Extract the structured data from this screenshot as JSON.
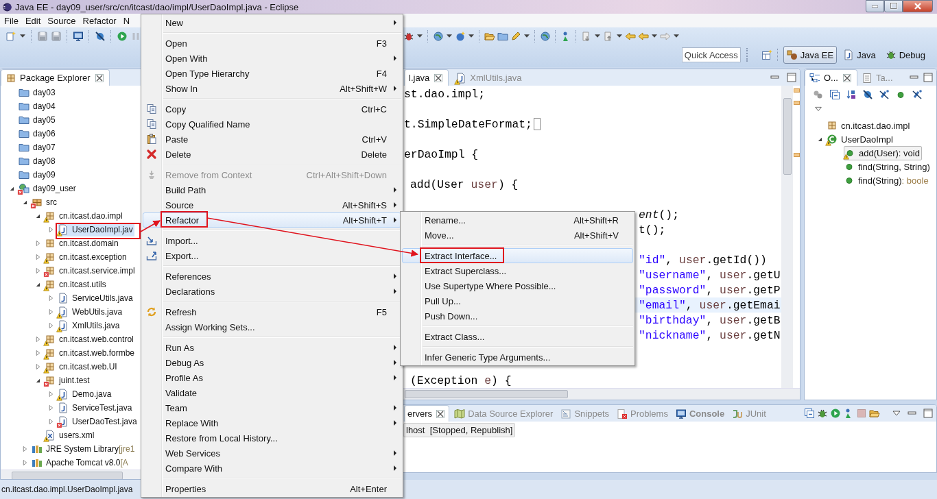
{
  "window": {
    "title": "Java EE - day09_user/src/cn/itcast/dao/impl/UserDaoImpl.java - Eclipse"
  },
  "menubar": [
    "File",
    "Edit",
    "Source",
    "Refactor",
    "N"
  ],
  "quick_access": {
    "placeholder": "Quick Access"
  },
  "perspectives": [
    {
      "label": "Java EE",
      "kind": "javaee",
      "selected": true
    },
    {
      "label": "Java",
      "kind": "java",
      "selected": false
    },
    {
      "label": "Debug",
      "kind": "debug",
      "selected": false
    }
  ],
  "package_explorer": {
    "title": "Package Explorer",
    "tree": [
      {
        "label": "day03",
        "kind": "folder",
        "warning": false,
        "error": false,
        "selected": false
      },
      {
        "label": "day04",
        "kind": "folder",
        "warning": false,
        "error": false,
        "selected": false
      },
      {
        "label": "day05",
        "kind": "folder",
        "warning": false,
        "error": false,
        "selected": false
      },
      {
        "label": "day06",
        "kind": "folder",
        "warning": false,
        "error": false,
        "selected": false
      },
      {
        "label": "day07",
        "kind": "folder",
        "warning": false,
        "error": false,
        "selected": false
      },
      {
        "label": "day08",
        "kind": "folder",
        "warning": false,
        "error": false,
        "selected": false
      },
      {
        "label": "day09",
        "kind": "folder",
        "warning": false,
        "error": false,
        "selected": false
      },
      {
        "label": "day09_user",
        "kind": "project",
        "warning": false,
        "error": true,
        "expanded": true,
        "selected": false,
        "children": [
          {
            "label": "src",
            "kind": "srcfolder",
            "warning": false,
            "error": true,
            "expanded": true,
            "selected": false,
            "children": [
              {
                "label": "cn.itcast.dao.impl",
                "kind": "package",
                "warning": true,
                "error": false,
                "expanded": true,
                "selected": false,
                "children": [
                  {
                    "label": "UserDaoImpl.jav",
                    "kind": "java",
                    "warning": true,
                    "error": false,
                    "expanded": false,
                    "selected": true
                  }
                ]
              },
              {
                "label": "cn.itcast.domain",
                "kind": "package",
                "warning": false,
                "error": false,
                "expanded": false,
                "selected": false
              },
              {
                "label": "cn.itcast.exception",
                "kind": "package",
                "warning": true,
                "error": false,
                "expanded": false,
                "selected": false
              },
              {
                "label": "cn.itcast.service.impl",
                "kind": "package",
                "warning": false,
                "error": true,
                "expanded": false,
                "selected": false
              },
              {
                "label": "cn.itcast.utils",
                "kind": "package",
                "warning": true,
                "error": false,
                "expanded": true,
                "selected": false,
                "children": [
                  {
                    "label": "ServiceUtils.java",
                    "kind": "java",
                    "warning": false,
                    "error": false,
                    "expanded": false,
                    "selected": false
                  },
                  {
                    "label": "WebUtils.java",
                    "kind": "java",
                    "warning": true,
                    "error": false,
                    "expanded": false,
                    "selected": false
                  },
                  {
                    "label": "XmlUtils.java",
                    "kind": "java",
                    "warning": true,
                    "error": false,
                    "expanded": false,
                    "selected": false
                  }
                ]
              },
              {
                "label": "cn.itcast.web.control",
                "kind": "package",
                "warning": true,
                "error": false,
                "expanded": false,
                "selected": false
              },
              {
                "label": "cn.itcast.web.formbe",
                "kind": "package",
                "warning": true,
                "error": false,
                "expanded": false,
                "selected": false
              },
              {
                "label": "cn.itcast.web.UI",
                "kind": "package",
                "warning": true,
                "error": false,
                "expanded": false,
                "selected": false
              },
              {
                "label": "juint.test",
                "kind": "package",
                "warning": false,
                "error": true,
                "expanded": true,
                "selected": false,
                "children": [
                  {
                    "label": "Demo.java",
                    "kind": "java",
                    "warning": true,
                    "error": false,
                    "expanded": false,
                    "selected": false
                  },
                  {
                    "label": "ServiceTest.java",
                    "kind": "java",
                    "warning": false,
                    "error": false,
                    "expanded": false,
                    "selected": false
                  },
                  {
                    "label": "UserDaoTest.java",
                    "kind": "java",
                    "warning": false,
                    "error": true,
                    "expanded": false,
                    "selected": false
                  }
                ]
              },
              {
                "label": "users.xml",
                "kind": "xml",
                "warning": true,
                "error": false,
                "selected": false
              }
            ]
          },
          {
            "label": "JRE System Library",
            "detail": "[jre1",
            "kind": "library",
            "warning": false,
            "error": false,
            "expanded": false,
            "selected": false
          },
          {
            "label": "Apache Tomcat v8.0",
            "detail": "[A",
            "kind": "library",
            "warning": false,
            "error": false,
            "expanded": false,
            "selected": false
          }
        ]
      }
    ]
  },
  "editor": {
    "tabs": [
      {
        "label": "l.java",
        "selected": true
      },
      {
        "label": "XmlUtils.java",
        "warning": true,
        "selected": false
      }
    ],
    "lines": [
      {
        "parts": [
          {
            "kind": "plain",
            "text": "st.dao.impl;"
          }
        ],
        "current": false,
        "folded": false
      },
      {
        "parts": [
          {
            "kind": "plain",
            "text": "t.SimpleDateFormat;"
          }
        ],
        "current": false,
        "folded": true
      },
      {
        "parts": [
          {
            "kind": "plain",
            "text": "erDaoImpl {"
          }
        ],
        "current": false,
        "folded": false
      },
      {
        "parts": [
          {
            "kind": "plain",
            "text": "add(User "
          },
          {
            "kind": "variable",
            "text": "user"
          },
          {
            "kind": "plain",
            "text": ") {"
          }
        ],
        "current": false,
        "folded": false
      },
      {
        "parts": [
          {
            "kind": "italic",
            "text": "ent"
          },
          {
            "kind": "plain",
            "text": "();"
          }
        ],
        "current": false,
        "folded": false
      },
      {
        "parts": [
          {
            "kind": "plain",
            "text": "t();"
          }
        ],
        "current": false,
        "folded": false
      },
      {
        "parts": [
          {
            "kind": "string",
            "text": "\"id\""
          },
          {
            "kind": "plain",
            "text": ", "
          },
          {
            "kind": "variable",
            "text": "user"
          },
          {
            "kind": "plain",
            "text": ".getId())"
          }
        ],
        "current": false,
        "folded": false
      },
      {
        "parts": [
          {
            "kind": "string",
            "text": "\"username\""
          },
          {
            "kind": "plain",
            "text": ", "
          },
          {
            "kind": "variable",
            "text": "user"
          },
          {
            "kind": "plain",
            "text": ".getU"
          }
        ],
        "current": false,
        "folded": false
      },
      {
        "parts": [
          {
            "kind": "string",
            "text": "\"password\""
          },
          {
            "kind": "plain",
            "text": ", "
          },
          {
            "kind": "variable",
            "text": "user"
          },
          {
            "kind": "plain",
            "text": ".getP"
          }
        ],
        "current": false,
        "folded": false
      },
      {
        "parts": [
          {
            "kind": "string",
            "text": "\"email\""
          },
          {
            "kind": "plain",
            "text": ", "
          },
          {
            "kind": "variable",
            "text": "user"
          },
          {
            "kind": "plain",
            "text": ".getEmai"
          }
        ],
        "current": true,
        "folded": false
      },
      {
        "parts": [
          {
            "kind": "string",
            "text": "\"birthday\""
          },
          {
            "kind": "plain",
            "text": ", "
          },
          {
            "kind": "variable",
            "text": "user"
          },
          {
            "kind": "plain",
            "text": ".getB"
          }
        ],
        "current": false,
        "folded": false
      },
      {
        "parts": [
          {
            "kind": "string",
            "text": "\"nickname\""
          },
          {
            "kind": "plain",
            "text": ", "
          },
          {
            "kind": "variable",
            "text": "user"
          },
          {
            "kind": "plain",
            "text": ".getN"
          }
        ],
        "current": false,
        "folded": false
      },
      {
        "parts": [
          {
            "kind": "plain",
            "text": "(Exception "
          },
          {
            "kind": "variable",
            "text": "e"
          },
          {
            "kind": "plain",
            "text": ") {"
          }
        ],
        "current": false,
        "folded": false
      }
    ]
  },
  "outline": {
    "tabs": [
      {
        "label": "O...",
        "kind": "outline",
        "selected": true
      },
      {
        "label": "Ta...",
        "kind": "tasks",
        "selected": false
      }
    ],
    "tree": [
      {
        "label": "cn.itcast.dao.impl",
        "kind": "package",
        "warning": false,
        "error": false,
        "selected": false
      },
      {
        "label": "UserDaoImpl",
        "kind": "class",
        "warning": true,
        "error": false,
        "expanded": true,
        "selected": false,
        "children": [
          {
            "label": "add(User)",
            "type": ": void",
            "kind": "method",
            "warning": true,
            "error": false,
            "selected": true
          },
          {
            "label": "find(String, String)",
            "kind": "method",
            "warning": false,
            "error": false,
            "selected": false
          },
          {
            "label": "find(String)",
            "type": ": boole",
            "kind": "method",
            "warning": false,
            "error": false,
            "selected": false
          }
        ]
      }
    ]
  },
  "bottom_panel": {
    "tabs": [
      {
        "label": "ervers",
        "selected": true,
        "bold": false
      },
      {
        "label": "Data Source Explorer",
        "kind": "datasource",
        "selected": false,
        "bold": false
      },
      {
        "label": "Snippets",
        "kind": "snippets",
        "selected": false,
        "bold": false
      },
      {
        "label": "Problems",
        "kind": "problems",
        "selected": false,
        "bold": false
      },
      {
        "label": "Console",
        "kind": "console",
        "selected": false,
        "bold": true
      },
      {
        "label": "JUnit",
        "kind": "junit",
        "selected": false,
        "bold": false
      }
    ],
    "rows": [
      {
        "name": "lhost",
        "status": "[Stopped, Republish]",
        "selected": true
      }
    ]
  },
  "status_bar": "cn.itcast.dao.impl.UserDaoImpl.java",
  "context_menu": [
    {
      "kind": "item",
      "label": "New",
      "submenu": true,
      "disabled": false,
      "selected": false
    },
    {
      "kind": "separator"
    },
    {
      "kind": "item",
      "label": "Open",
      "shortcut": "F3",
      "submenu": false,
      "disabled": false,
      "selected": false
    },
    {
      "kind": "item",
      "label": "Open With",
      "submenu": true,
      "disabled": false,
      "selected": false
    },
    {
      "kind": "item",
      "label": "Open Type Hierarchy",
      "shortcut": "F4",
      "submenu": false,
      "disabled": false,
      "selected": false
    },
    {
      "kind": "item",
      "label": "Show In",
      "shortcut": "Alt+Shift+W",
      "submenu": true,
      "disabled": false,
      "selected": false
    },
    {
      "kind": "separator"
    },
    {
      "kind": "item",
      "label": "Copy",
      "shortcut": "Ctrl+C",
      "submenu": false,
      "disabled": false,
      "selected": false
    },
    {
      "kind": "item",
      "label": "Copy Qualified Name",
      "submenu": false,
      "disabled": false,
      "selected": false
    },
    {
      "kind": "item",
      "label": "Paste",
      "shortcut": "Ctrl+V",
      "submenu": false,
      "disabled": false,
      "selected": false
    },
    {
      "kind": "item",
      "label": "Delete",
      "shortcut": "Delete",
      "submenu": false,
      "disabled": false,
      "selected": false
    },
    {
      "kind": "separator"
    },
    {
      "kind": "item",
      "label": "Remove from Context",
      "shortcut": "Ctrl+Alt+Shift+Down",
      "submenu": false,
      "disabled": true,
      "selected": false
    },
    {
      "kind": "item",
      "label": "Build Path",
      "submenu": true,
      "disabled": false,
      "selected": false
    },
    {
      "kind": "item",
      "label": "Source",
      "shortcut": "Alt+Shift+S",
      "submenu": true,
      "disabled": false,
      "selected": false
    },
    {
      "kind": "item",
      "label": "Refactor",
      "shortcut": "Alt+Shift+T",
      "submenu": true,
      "disabled": false,
      "selected": true
    },
    {
      "kind": "separator"
    },
    {
      "kind": "item",
      "label": "Import...",
      "submenu": false,
      "disabled": false,
      "selected": false
    },
    {
      "kind": "item",
      "label": "Export...",
      "submenu": false,
      "disabled": false,
      "selected": false
    },
    {
      "kind": "separator"
    },
    {
      "kind": "item",
      "label": "References",
      "submenu": true,
      "disabled": false,
      "selected": false
    },
    {
      "kind": "item",
      "label": "Declarations",
      "submenu": true,
      "disabled": false,
      "selected": false
    },
    {
      "kind": "separator"
    },
    {
      "kind": "item",
      "label": "Refresh",
      "shortcut": "F5",
      "submenu": false,
      "disabled": false,
      "selected": false
    },
    {
      "kind": "item",
      "label": "Assign Working Sets...",
      "submenu": false,
      "disabled": false,
      "selected": false
    },
    {
      "kind": "separator"
    },
    {
      "kind": "item",
      "label": "Run As",
      "submenu": true,
      "disabled": false,
      "selected": false
    },
    {
      "kind": "item",
      "label": "Debug As",
      "submenu": true,
      "disabled": false,
      "selected": false
    },
    {
      "kind": "item",
      "label": "Profile As",
      "submenu": true,
      "disabled": false,
      "selected": false
    },
    {
      "kind": "item",
      "label": "Validate",
      "submenu": false,
      "disabled": false,
      "selected": false
    },
    {
      "kind": "item",
      "label": "Team",
      "submenu": true,
      "disabled": false,
      "selected": false
    },
    {
      "kind": "item",
      "label": "Replace With",
      "submenu": true,
      "disabled": false,
      "selected": false
    },
    {
      "kind": "item",
      "label": "Restore from Local History...",
      "submenu": false,
      "disabled": false,
      "selected": false
    },
    {
      "kind": "item",
      "label": "Web Services",
      "submenu": true,
      "disabled": false,
      "selected": false
    },
    {
      "kind": "item",
      "label": "Compare With",
      "submenu": true,
      "disabled": false,
      "selected": false
    },
    {
      "kind": "separator"
    },
    {
      "kind": "item",
      "label": "Properties",
      "shortcut": "Alt+Enter",
      "submenu": false,
      "disabled": false,
      "selected": false
    }
  ],
  "refactor_submenu": [
    {
      "kind": "item",
      "label": "Rename...",
      "shortcut": "Alt+Shift+R",
      "selected": false
    },
    {
      "kind": "item",
      "label": "Move...",
      "shortcut": "Alt+Shift+V",
      "selected": false
    },
    {
      "kind": "separator"
    },
    {
      "kind": "item",
      "label": "Extract Interface...",
      "selected": true
    },
    {
      "kind": "item",
      "label": "Extract Superclass...",
      "selected": false
    },
    {
      "kind": "item",
      "label": "Use Supertype Where Possible...",
      "selected": false
    },
    {
      "kind": "item",
      "label": "Pull Up...",
      "selected": false
    },
    {
      "kind": "item",
      "label": "Push Down...",
      "selected": false
    },
    {
      "kind": "separator"
    },
    {
      "kind": "item",
      "label": "Extract Class...",
      "selected": false
    },
    {
      "kind": "separator"
    },
    {
      "kind": "item",
      "label": "Infer Generic Type Arguments...",
      "selected": false
    }
  ]
}
